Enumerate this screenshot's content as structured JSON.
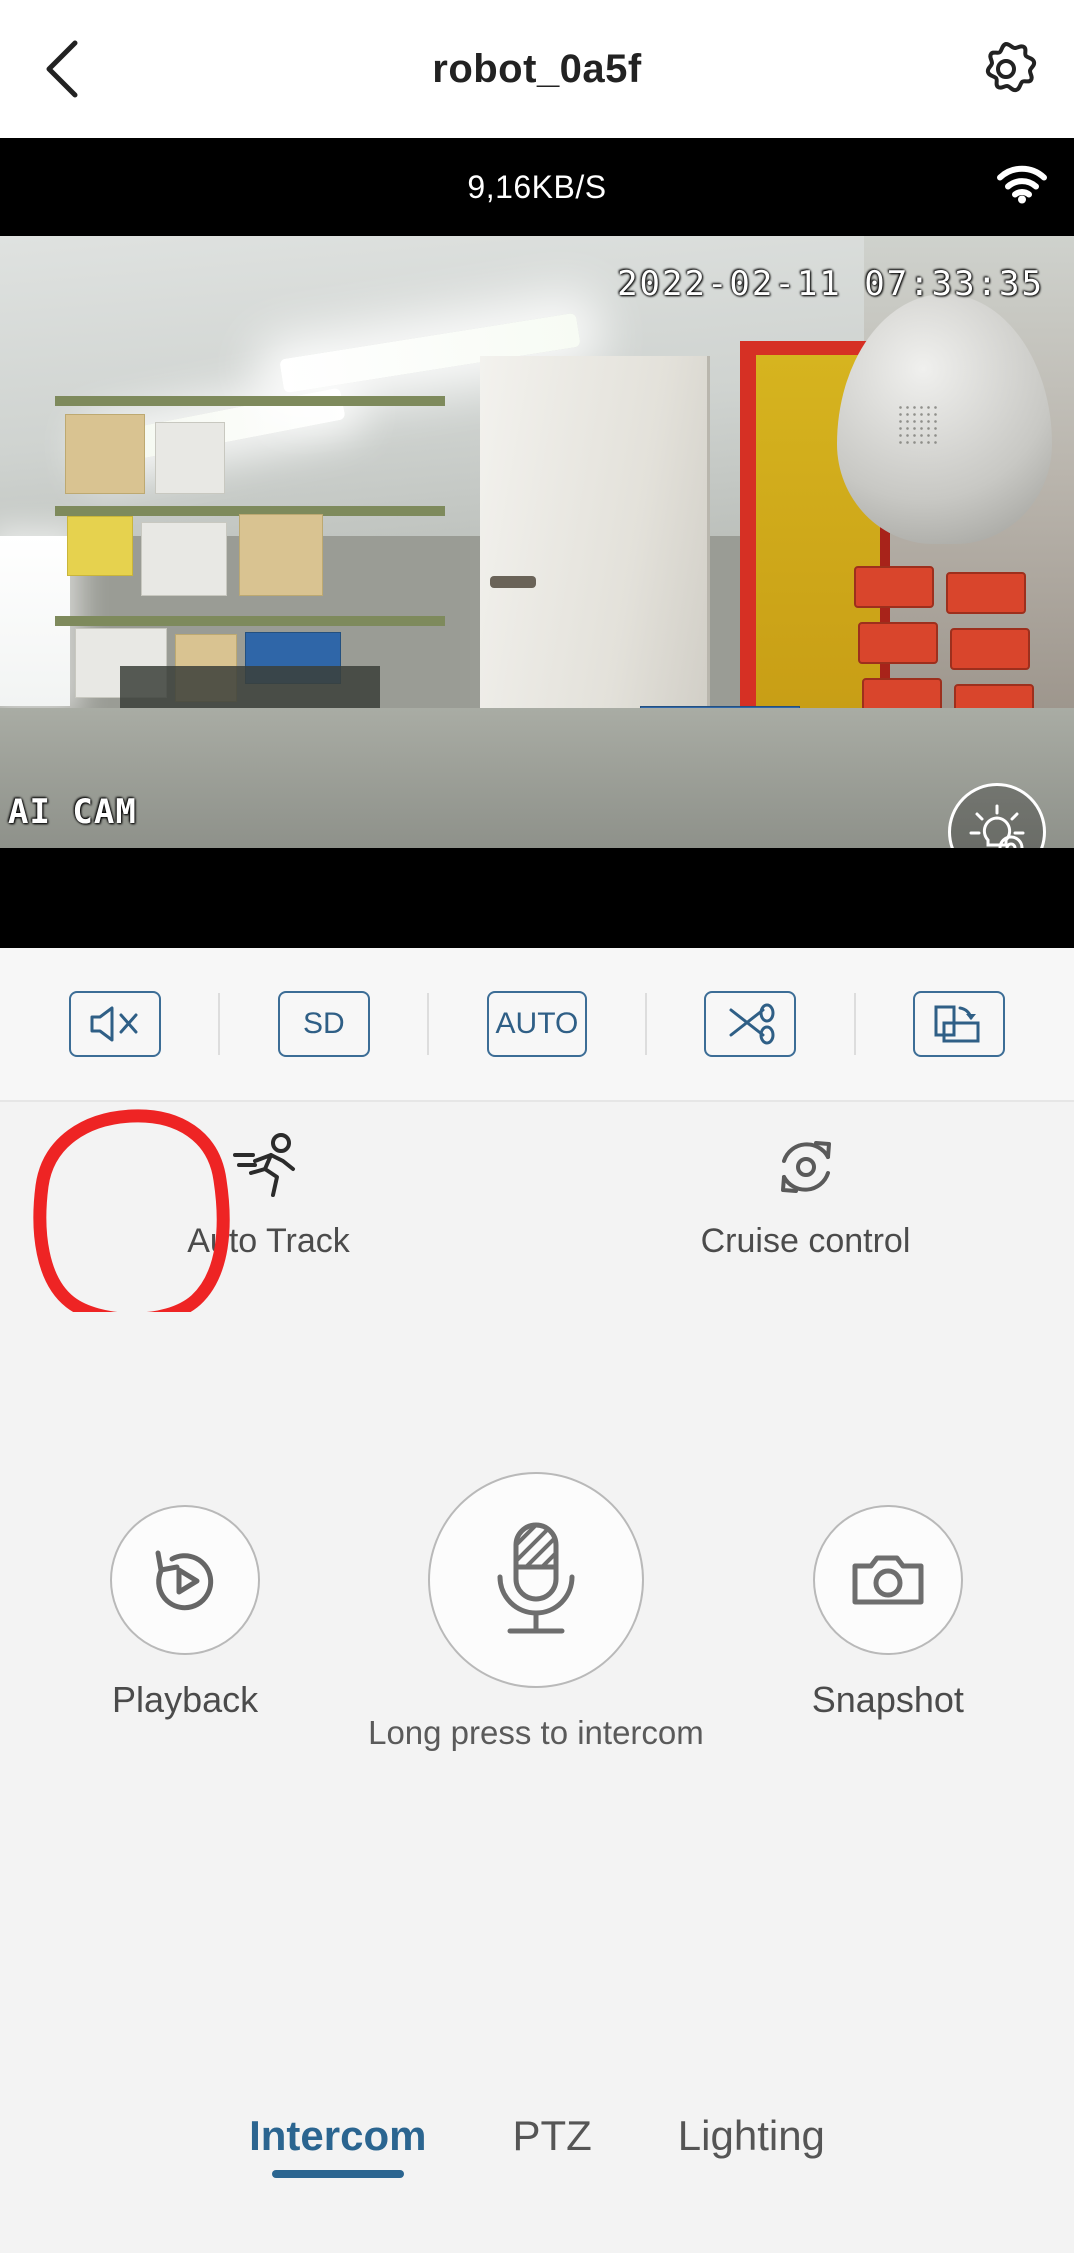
{
  "header": {
    "title": "robot_0a5f",
    "back_icon": "chevron-left-icon",
    "settings_icon": "gear-icon"
  },
  "video": {
    "bitrate": "9,16KB/S",
    "wifi_icon": "wifi-icon",
    "timestamp_overlay": "2022-02-11 07:33:35",
    "watermark": "AI CAM",
    "light_button_icon": "lightbulb-gear-icon"
  },
  "toolbar": {
    "items": [
      {
        "name": "mute-toggle",
        "icon": "speaker-mute-icon",
        "label": ""
      },
      {
        "name": "quality-toggle",
        "icon": "",
        "label": "SD"
      },
      {
        "name": "auto-toggle",
        "icon": "",
        "label": "AUTO"
      },
      {
        "name": "record-clip",
        "icon": "scissors-icon",
        "label": ""
      },
      {
        "name": "screen-rotate",
        "icon": "screen-rotate-icon",
        "label": ""
      }
    ]
  },
  "features": [
    {
      "label": "Auto Track",
      "icon": "running-person-icon",
      "highlighted": true
    },
    {
      "label": "Cruise control",
      "icon": "rotate-circle-icon",
      "highlighted": false
    }
  ],
  "actions": {
    "playback": {
      "label": "Playback",
      "icon": "replay-play-icon"
    },
    "intercom": {
      "label": "Long press to intercom",
      "icon": "microphone-icon"
    },
    "snapshot": {
      "label": "Snapshot",
      "icon": "camera-icon"
    }
  },
  "tabs": [
    {
      "label": "Intercom",
      "active": true
    },
    {
      "label": "PTZ",
      "active": false
    },
    {
      "label": "Lighting",
      "active": false
    }
  ],
  "colors": {
    "accent": "#2b6590",
    "toolbar_icon": "#2f5f86",
    "annotation": "#ee2424",
    "text": "#4b4b4b"
  }
}
